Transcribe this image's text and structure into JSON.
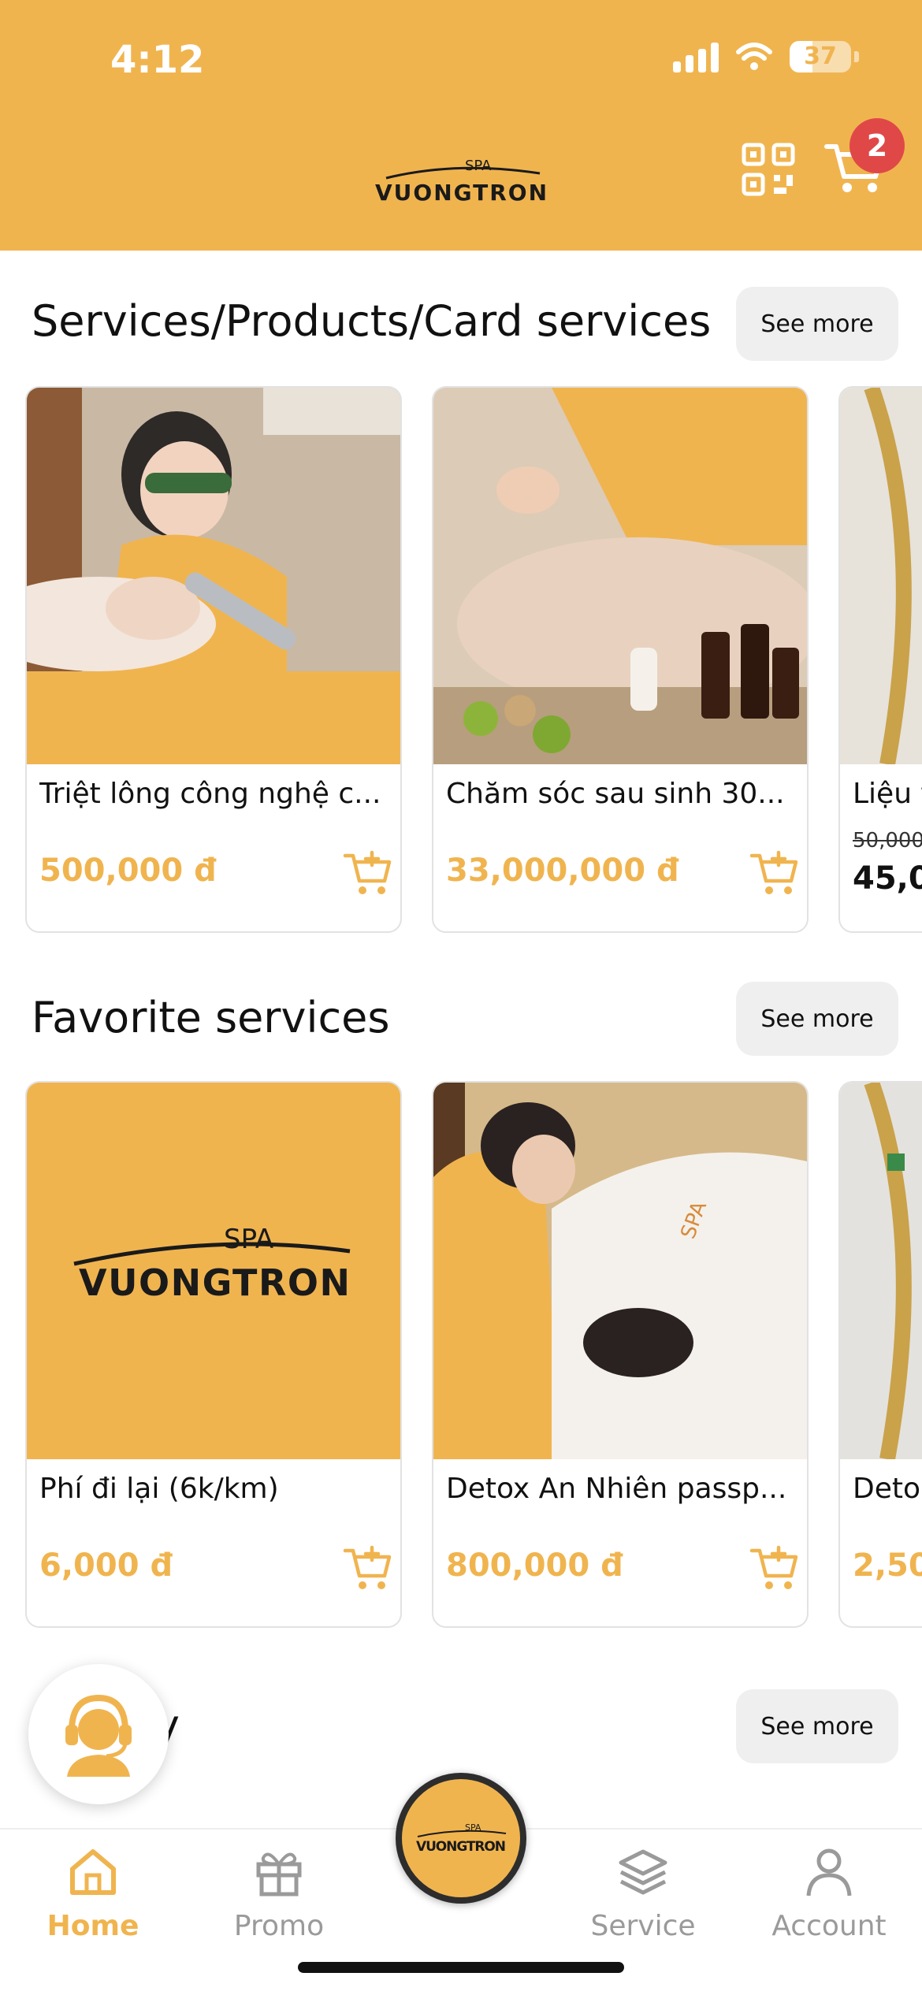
{
  "status_bar": {
    "time": "4:12",
    "battery": "37",
    "battery_level": 0.37
  },
  "header": {
    "logo_text_top": "SPA",
    "logo_text_main": "VUONGTRON",
    "qr_icon": "qr-code-icon",
    "cart_icon": "cart-icon",
    "cart_count": "2"
  },
  "sections": [
    {
      "title": "Services/Products/Card services",
      "see_more": "See more",
      "cards": [
        {
          "name": "Triệt lông công nghệ c...",
          "price": "500,000 đ"
        },
        {
          "name": "Chăm sóc sau sinh 30...",
          "price": "33,000,000 đ"
        },
        {
          "name": "Liệu t",
          "old_price": "50,000",
          "price": "45,0"
        }
      ]
    },
    {
      "title": "Favorite services",
      "see_more": "See more",
      "cards": [
        {
          "name": "Phí đi lại (6k/km)",
          "price": "6,000 đ"
        },
        {
          "name": "Detox An Nhiên passp...",
          "price": "800,000 đ"
        },
        {
          "name": "Deto",
          "price": "2,50"
        }
      ]
    },
    {
      "title": "y",
      "see_more": "See more"
    }
  ],
  "support_icon": "headset-support-icon",
  "bottom_nav": {
    "items": [
      {
        "label": "Home",
        "icon": "home-icon",
        "active": true
      },
      {
        "label": "Promo",
        "icon": "gift-icon",
        "active": false
      },
      {
        "label": "Service",
        "icon": "layers-icon",
        "active": false
      },
      {
        "label": "Account",
        "icon": "user-icon",
        "active": false
      }
    ],
    "center_logo_top": "SPA",
    "center_logo_main": "VUONGTRON"
  },
  "colors": {
    "brand": "#F0B44F",
    "badge": "#E04848"
  }
}
